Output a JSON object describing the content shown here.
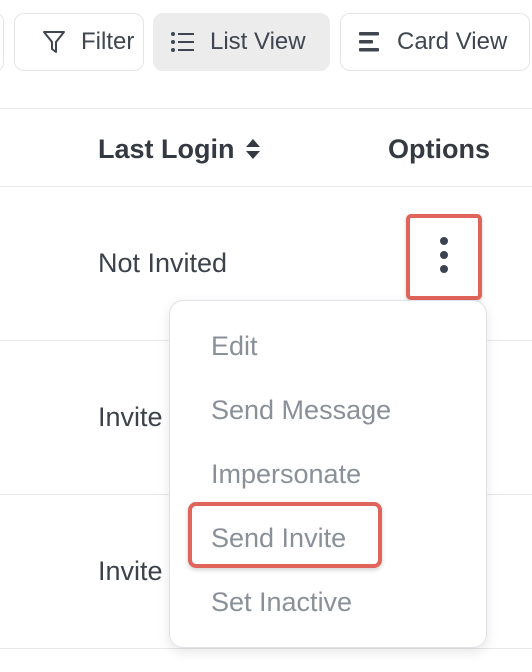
{
  "toolbar": {
    "filter_label": "Filter",
    "list_view_label": "List View",
    "card_view_label": "Card View",
    "active_view": "List View"
  },
  "table": {
    "columns": [
      "Last Login",
      "Options"
    ],
    "rows": [
      {
        "last_login": "Not Invited"
      },
      {
        "last_login": "Invite"
      },
      {
        "last_login": "Invite"
      }
    ]
  },
  "options_menu": {
    "items": [
      "Edit",
      "Send Message",
      "Impersonate",
      "Send Invite",
      "Set Inactive"
    ],
    "highlighted": "Send Invite"
  },
  "colors": {
    "highlight": "#e0645a",
    "menu_text": "#8a9099",
    "header_text": "#353a42"
  }
}
